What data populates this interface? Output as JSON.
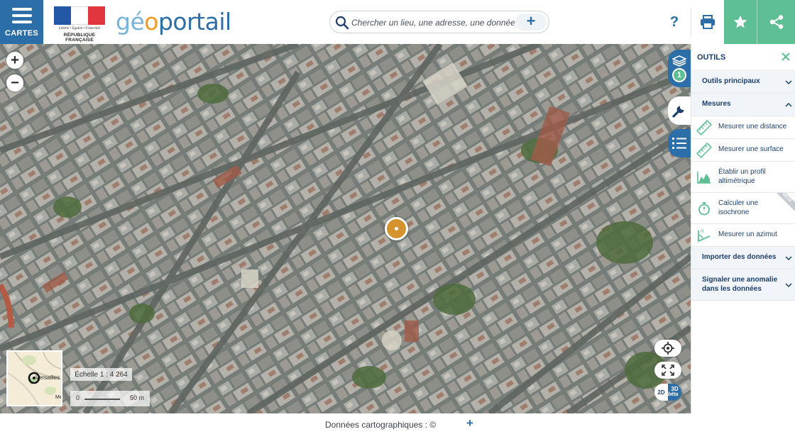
{
  "header": {
    "menu_label": "CARTES",
    "rf_motto": "Liberté • Égalité • Fraternité",
    "rf_name": "RÉPUBLIQUE FRANÇAISE",
    "logo": {
      "part1": "gé",
      "part2": "o",
      "part3": "portail"
    },
    "search": {
      "placeholder": "Chercher un lieu, une adresse, une donnée",
      "value": "",
      "add_label": "+"
    },
    "help_label": "?",
    "icons": {
      "print": "print-icon",
      "favorite": "star-icon",
      "share": "share-icon",
      "menu": "hamburger-icon",
      "search": "search-icon"
    }
  },
  "map": {
    "zoom_in_label": "+",
    "zoom_out_label": "−",
    "scale_text": "Échelle 1 : 4 264",
    "scale_bar": {
      "start": "0",
      "end": "50 m"
    },
    "overview": {
      "label_1": "Versailles",
      "label_2": "Me"
    },
    "dimension": {
      "two_d": "2D",
      "three_d": "3D",
      "beta": "bêta"
    },
    "layer_count": "1"
  },
  "panel": {
    "title": "OUTILS",
    "sections": {
      "main_tools": "Outils principaux",
      "measures": "Mesures",
      "import": "Importer des données",
      "report": "Signaler une anomalie dans les données"
    },
    "tools": {
      "distance": "Mesurer une distance",
      "surface": "Mesurer une surface",
      "profile": "Établir un profil altimétrique",
      "isochrone": "Calculer une isochrone",
      "azimuth": "Mesurer un azimut"
    },
    "beta_badge": "BETA"
  },
  "footer": {
    "text": "Données cartographiques : ©",
    "add_label": "+"
  },
  "colors": {
    "primary_blue": "#2c6fa8",
    "accent_green": "#5fbf94",
    "logo_light_blue": "#78b3d9",
    "logo_orange": "#ef9a25",
    "marker_orange": "#d4932c"
  }
}
